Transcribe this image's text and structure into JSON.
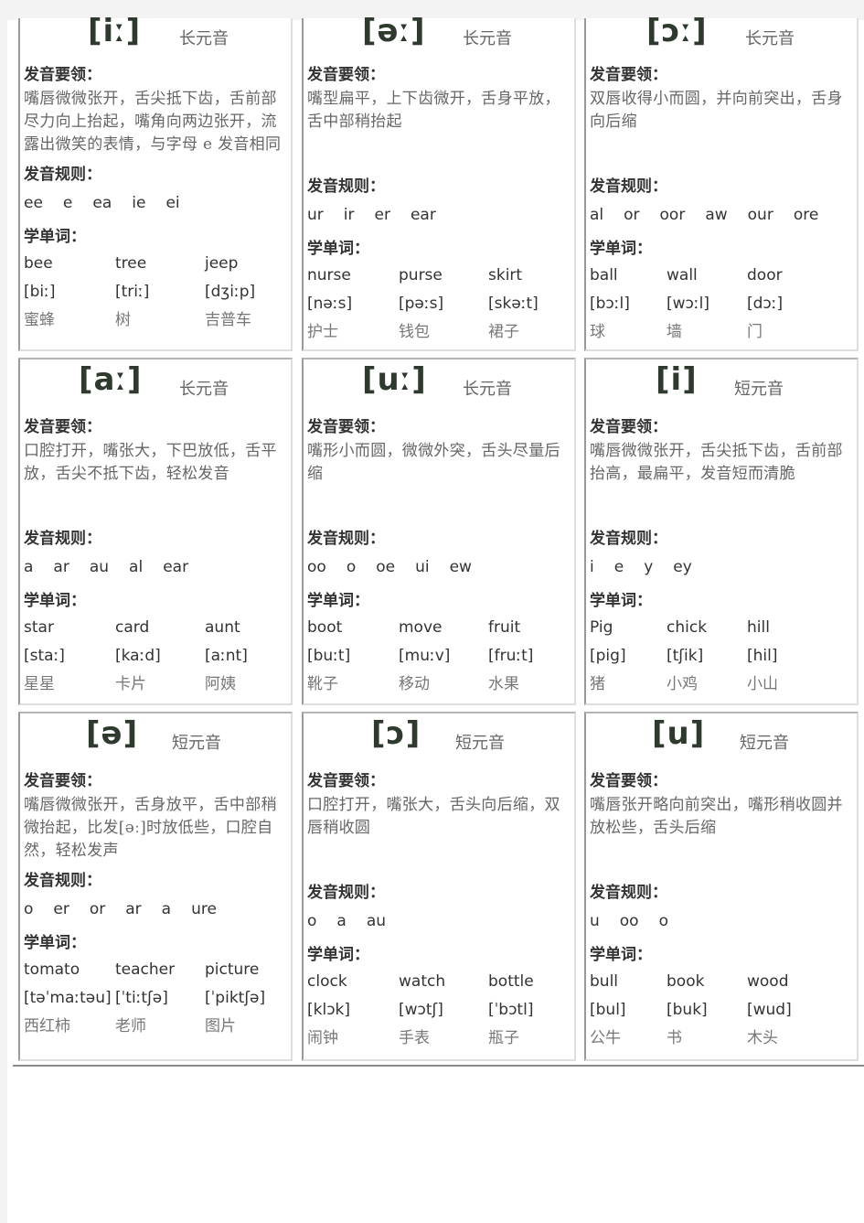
{
  "labels": {
    "tips": "发音要领：",
    "rules": "发音规则：",
    "words": "学单词："
  },
  "cards": [
    {
      "ipa": "[iː]",
      "type": "长元音",
      "tips": "嘴唇微微张开，舌尖抵下齿，舌前部尽力向上抬起，嘴角向两边张开，流露出微笑的表情，与字母 e 发音相同",
      "rules": [
        "ee",
        "e",
        "ea",
        "ie",
        "ei"
      ],
      "words": [
        "bee",
        "tree",
        "jeep"
      ],
      "phonetics": [
        "[biː]",
        "[triː]",
        "[dʒiːp]"
      ],
      "meanings": [
        "蜜蜂",
        "树",
        "吉普车"
      ]
    },
    {
      "ipa": "[əː]",
      "type": "长元音",
      "tips": "嘴型扁平，上下齿微开，舌身平放，舌中部稍抬起",
      "rules": [
        "ur",
        "ir",
        "er",
        "ear"
      ],
      "words": [
        "nurse",
        "purse",
        "skirt"
      ],
      "phonetics": [
        "[nəːs]",
        "[pəːs]",
        "[skəːt]"
      ],
      "meanings": [
        "护士",
        "钱包",
        "裙子"
      ]
    },
    {
      "ipa": "[ɔː]",
      "type": "长元音",
      "tips": "双唇收得小而圆，并向前突出，舌身向后缩",
      "rules": [
        "al",
        "or",
        "oor",
        "aw",
        "our",
        "ore"
      ],
      "words": [
        "ball",
        "wall",
        "door"
      ],
      "phonetics": [
        "[bɔːl]",
        "[wɔːl]",
        "[dɔː]"
      ],
      "meanings": [
        "球",
        "墙",
        "门"
      ]
    },
    {
      "ipa": "[aː]",
      "type": "长元音",
      "tips": "口腔打开，嘴张大，下巴放低，舌平放，舌尖不抵下齿，轻松发音",
      "rules": [
        "a",
        "ar",
        "au",
        "al",
        "ear"
      ],
      "words": [
        "star",
        "card",
        "aunt"
      ],
      "phonetics": [
        "[staː]",
        "[kaːd]",
        "[aːnt]"
      ],
      "meanings": [
        "星星",
        "卡片",
        "阿姨"
      ]
    },
    {
      "ipa": "[uː]",
      "type": "长元音",
      "tips": "嘴形小而圆，微微外突，舌头尽量后缩",
      "rules": [
        "oo",
        "o",
        "oe",
        "ui",
        "ew"
      ],
      "words": [
        "boot",
        "move",
        "fruit"
      ],
      "phonetics": [
        "[buːt]",
        "[muːv]",
        "[fruːt]"
      ],
      "meanings": [
        "靴子",
        "移动",
        "水果"
      ]
    },
    {
      "ipa": "[i]",
      "type": "短元音",
      "tips": "嘴唇微微张开，舌尖抵下齿，舌前部抬高，最扁平，发音短而清脆",
      "rules": [
        "i",
        "e",
        "y",
        "ey"
      ],
      "words": [
        "Pig",
        "chick",
        "hill"
      ],
      "phonetics": [
        "[pig]",
        "[tʃik]",
        "[hil]"
      ],
      "meanings": [
        "猪",
        "小鸡",
        "小山"
      ]
    },
    {
      "ipa": "[ə]",
      "type": "短元音",
      "tips": "嘴唇微微张开，舌身放平，舌中部稍微抬起，比发[əː]时放低些，口腔自然，轻松发声",
      "rules": [
        "o",
        "er",
        "or",
        "ar",
        "a",
        "ure"
      ],
      "words": [
        "tomato",
        "teacher",
        "picture"
      ],
      "phonetics": [
        "[təˈmaːtəu]",
        "[ˈtiːtʃə]",
        "[ˈpiktʃə]"
      ],
      "meanings": [
        "西红柿",
        "老师",
        "图片"
      ]
    },
    {
      "ipa": "[ɔ]",
      "type": "短元音",
      "tips": "口腔打开，嘴张大，舌头向后缩，双唇稍收圆",
      "rules": [
        "o",
        "a",
        "au"
      ],
      "words": [
        "clock",
        "watch",
        "bottle"
      ],
      "phonetics": [
        "[klɔk]",
        "[wɔtʃ]",
        "[ˈbɔtl]"
      ],
      "meanings": [
        "闹钟",
        "手表",
        "瓶子"
      ]
    },
    {
      "ipa": "[u]",
      "type": "短元音",
      "tips": "嘴唇张开略向前突出，嘴形稍收圆并放松些，舌头后缩",
      "rules": [
        "u",
        "oo",
        "o"
      ],
      "words": [
        "bull",
        "book",
        "wood"
      ],
      "phonetics": [
        "[bul]",
        "[buk]",
        "[wud]"
      ],
      "meanings": [
        "公牛",
        "书",
        "木头"
      ]
    }
  ]
}
